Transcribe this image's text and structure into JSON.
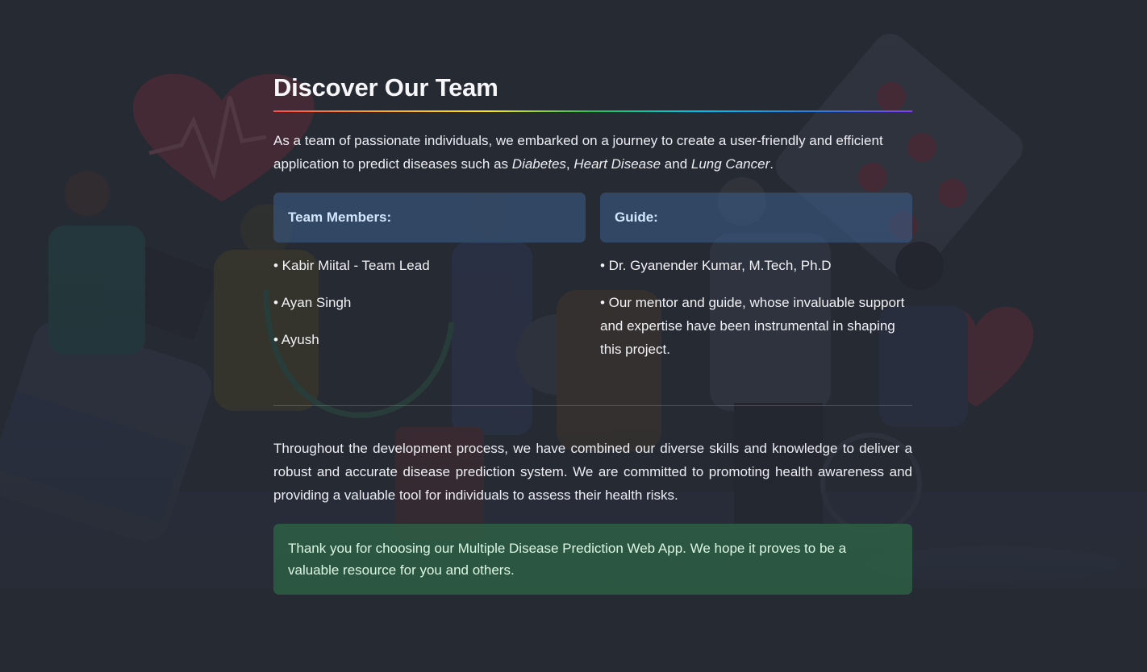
{
  "header": {
    "title": "Discover Our Team"
  },
  "intro": {
    "text_a": "As a team of passionate individuals, we embarked on a journey to create a user-friendly and efficient application to predict diseases such as ",
    "disease_1": "Diabetes",
    "sep_1": ", ",
    "disease_2": "Heart Disease",
    "sep_2": " and ",
    "disease_3": "Lung Cancer",
    "end": "."
  },
  "team": {
    "heading": "Team Members:",
    "members": [
      "• Kabir Miital - Team Lead",
      "• Ayan Singh",
      "• Ayush"
    ]
  },
  "guide": {
    "heading": "Guide:",
    "items": [
      "• Dr. Gyanender Kumar, M.Tech, Ph.D",
      "• Our mentor and guide, whose invaluable support and expertise have been instrumental in shaping this project."
    ]
  },
  "body": "Throughout the development process, we have combined our diverse skills and knowledge to deliver a robust and accurate disease prediction system. We are committed to promoting health awareness and providing a valuable tool for individuals to assess their health risks.",
  "success_message": "Thank you for choosing our Multiple Disease Prediction Web App. We hope it proves to be a valuable resource for you and others.",
  "colors": {
    "background": "#262a33",
    "info": "#3d5f8c",
    "success": "#2e6e48",
    "text": "#e8eaee"
  }
}
